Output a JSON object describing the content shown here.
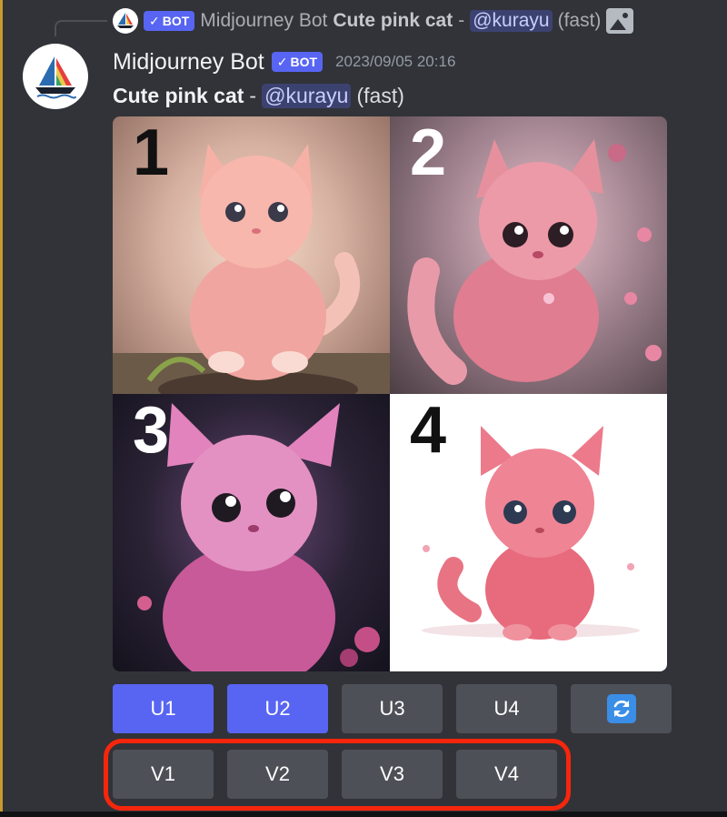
{
  "reply": {
    "bot_name": "Midjourney Bot",
    "bot_tag": "BOT",
    "prompt": "Cute pink cat",
    "separator": "-",
    "mention": "@kurayu",
    "speed": "(fast)"
  },
  "message": {
    "username": "Midjourney Bot",
    "bot_tag": "BOT",
    "timestamp": "2023/09/05 20:16",
    "prompt": "Cute pink cat",
    "separator": "-",
    "mention": "@kurayu",
    "speed": "(fast)"
  },
  "image_grid": {
    "cells": [
      {
        "number": "1"
      },
      {
        "number": "2"
      },
      {
        "number": "3"
      },
      {
        "number": "4"
      }
    ]
  },
  "buttons": {
    "upscale": [
      "U1",
      "U2",
      "U3",
      "U4"
    ],
    "variation": [
      "V1",
      "V2",
      "V3",
      "V4"
    ],
    "reroll_icon": "refresh-icon"
  },
  "colors": {
    "blurple": "#5865f2",
    "button_gray": "#4e5058",
    "highlight_red": "#f6260c",
    "background": "#313338"
  }
}
